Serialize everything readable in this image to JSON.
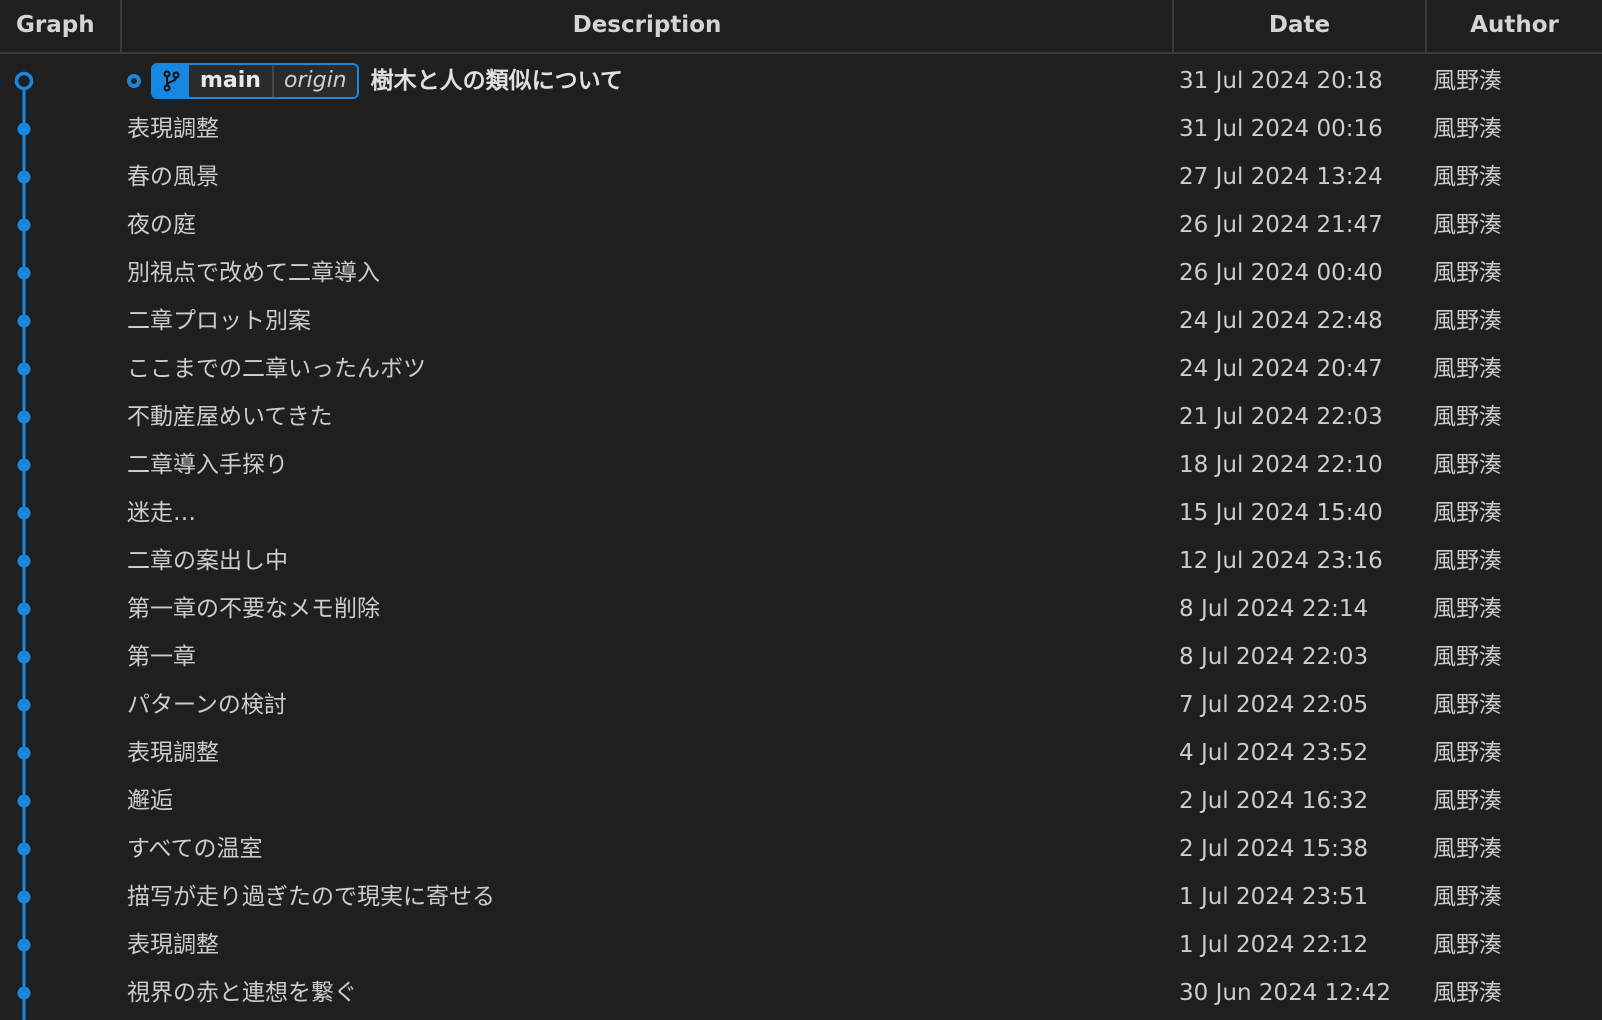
{
  "columns": {
    "graph": "Graph",
    "description": "Description",
    "date": "Date",
    "author": "Author"
  },
  "accent_color": "#1787e0",
  "head": {
    "branch_icon": "git-branch-icon",
    "branch": "main",
    "remote": "origin"
  },
  "commits": [
    {
      "description": "樹木と人の類似について",
      "date": "31 Jul 2024 20:18",
      "author": "風野湊"
    },
    {
      "description": "表現調整",
      "date": "31 Jul 2024 00:16",
      "author": "風野湊"
    },
    {
      "description": "春の風景",
      "date": "27 Jul 2024 13:24",
      "author": "風野湊"
    },
    {
      "description": "夜の庭",
      "date": "26 Jul 2024 21:47",
      "author": "風野湊"
    },
    {
      "description": "別視点で改めて二章導入",
      "date": "26 Jul 2024 00:40",
      "author": "風野湊"
    },
    {
      "description": "二章プロット別案",
      "date": "24 Jul 2024 22:48",
      "author": "風野湊"
    },
    {
      "description": "ここまでの二章いったんボツ",
      "date": "24 Jul 2024 20:47",
      "author": "風野湊"
    },
    {
      "description": "不動産屋めいてきた",
      "date": "21 Jul 2024 22:03",
      "author": "風野湊"
    },
    {
      "description": "二章導入手探り",
      "date": "18 Jul 2024 22:10",
      "author": "風野湊"
    },
    {
      "description": "迷走…",
      "date": "15 Jul 2024 15:40",
      "author": "風野湊"
    },
    {
      "description": "二章の案出し中",
      "date": "12 Jul 2024 23:16",
      "author": "風野湊"
    },
    {
      "description": "第一章の不要なメモ削除",
      "date": "8 Jul 2024 22:14",
      "author": "風野湊"
    },
    {
      "description": "第一章",
      "date": "8 Jul 2024 22:03",
      "author": "風野湊"
    },
    {
      "description": "パターンの検討",
      "date": "7 Jul 2024 22:05",
      "author": "風野湊"
    },
    {
      "description": "表現調整",
      "date": "4 Jul 2024 23:52",
      "author": "風野湊"
    },
    {
      "description": "邂逅",
      "date": "2 Jul 2024 16:32",
      "author": "風野湊"
    },
    {
      "description": "すべての温室",
      "date": "2 Jul 2024 15:38",
      "author": "風野湊"
    },
    {
      "description": "描写が走り過ぎたので現実に寄せる",
      "date": "1 Jul 2024 23:51",
      "author": "風野湊"
    },
    {
      "description": "表現調整",
      "date": "1 Jul 2024 22:12",
      "author": "風野湊"
    },
    {
      "description": "視界の赤と連想を繋ぐ",
      "date": "30 Jun 2024 12:42",
      "author": "風野湊"
    }
  ]
}
